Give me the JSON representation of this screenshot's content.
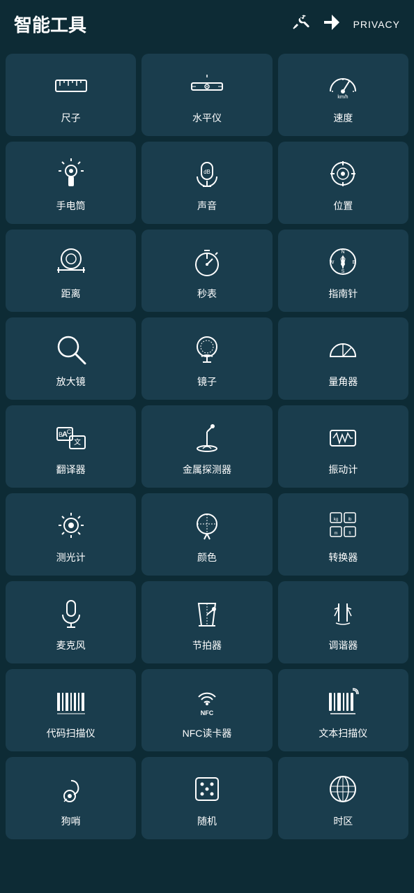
{
  "header": {
    "title": "智能工具",
    "privacy_label": "PRIVACY"
  },
  "tools": [
    {
      "id": "ruler",
      "label": "尺子",
      "icon": "ruler"
    },
    {
      "id": "level",
      "label": "水平仪",
      "icon": "level"
    },
    {
      "id": "speed",
      "label": "速度",
      "icon": "speed"
    },
    {
      "id": "flashlight",
      "label": "手电筒",
      "icon": "flashlight"
    },
    {
      "id": "sound",
      "label": "声音",
      "icon": "sound"
    },
    {
      "id": "location",
      "label": "位置",
      "icon": "location"
    },
    {
      "id": "distance",
      "label": "距离",
      "icon": "distance"
    },
    {
      "id": "stopwatch",
      "label": "秒表",
      "icon": "stopwatch"
    },
    {
      "id": "compass",
      "label": "指南针",
      "icon": "compass"
    },
    {
      "id": "magnifier",
      "label": "放大镜",
      "icon": "magnifier"
    },
    {
      "id": "mirror",
      "label": "镜子",
      "icon": "mirror"
    },
    {
      "id": "protractor",
      "label": "量角器",
      "icon": "protractor"
    },
    {
      "id": "translator",
      "label": "翻译器",
      "icon": "translator"
    },
    {
      "id": "metal_detector",
      "label": "金属探测器",
      "icon": "metal_detector"
    },
    {
      "id": "vibrometer",
      "label": "振动计",
      "icon": "vibrometer"
    },
    {
      "id": "light_meter",
      "label": "测光计",
      "icon": "light_meter"
    },
    {
      "id": "color",
      "label": "颜色",
      "icon": "color"
    },
    {
      "id": "converter",
      "label": "转换器",
      "icon": "converter"
    },
    {
      "id": "microphone",
      "label": "麦克风",
      "icon": "microphone"
    },
    {
      "id": "metronome",
      "label": "节拍器",
      "icon": "metronome"
    },
    {
      "id": "tuner",
      "label": "调谐器",
      "icon": "tuner"
    },
    {
      "id": "barcode",
      "label": "代码扫描仪",
      "icon": "barcode"
    },
    {
      "id": "nfc",
      "label": "NFC读卡器",
      "icon": "nfc"
    },
    {
      "id": "text_scanner",
      "label": "文本扫描仪",
      "icon": "text_scanner"
    },
    {
      "id": "dog_whistle",
      "label": "狗哨",
      "icon": "dog_whistle"
    },
    {
      "id": "random",
      "label": "随机",
      "icon": "random"
    },
    {
      "id": "timezone",
      "label": "时区",
      "icon": "timezone"
    }
  ]
}
